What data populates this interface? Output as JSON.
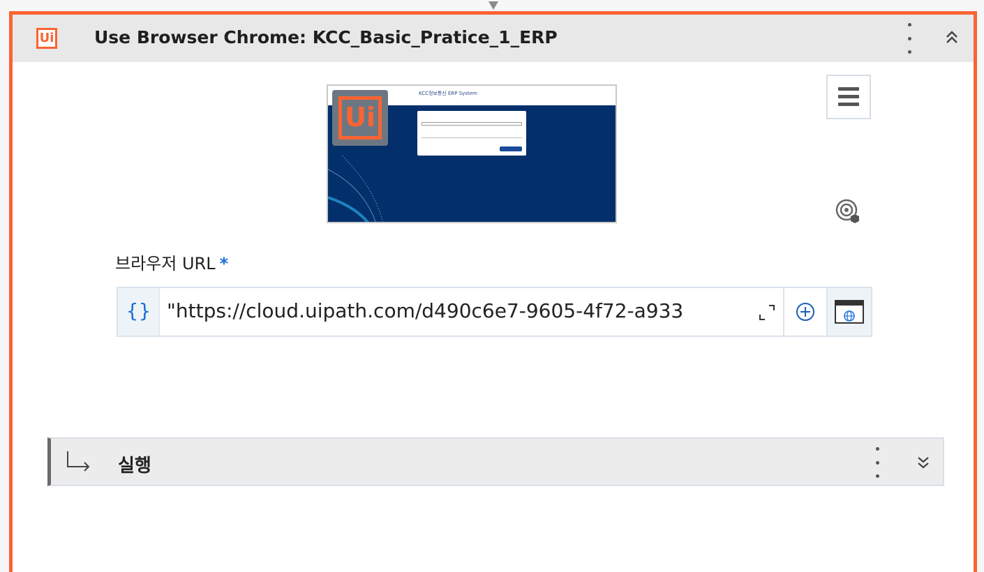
{
  "activity": {
    "logo_text": "Ui",
    "title": "Use Browser Chrome: KCC_Basic_Pratice_1_ERP"
  },
  "preview": {
    "brand_text": "KCC정보통신 ERP System",
    "badge_text": "Ui"
  },
  "url_field": {
    "label": "브라우저 URL",
    "required_mark": "*",
    "expression_icon": "{}",
    "value": "\"https://cloud.uipath.com/d490c6e7-9605-4f72-a933"
  },
  "sequence": {
    "label": "실행"
  },
  "colors": {
    "accent": "#fa6433",
    "link_blue": "#1a6fd8",
    "header_bg": "#e8e8e8"
  },
  "icons": [
    "ui-logo-icon",
    "kebab-menu-icon",
    "collapse-icon",
    "hamburger-menu-icon",
    "target-icon",
    "expression-icon",
    "expand-icon",
    "add-icon",
    "browser-icon",
    "arrow-return-icon",
    "expand-chevron-icon"
  ]
}
